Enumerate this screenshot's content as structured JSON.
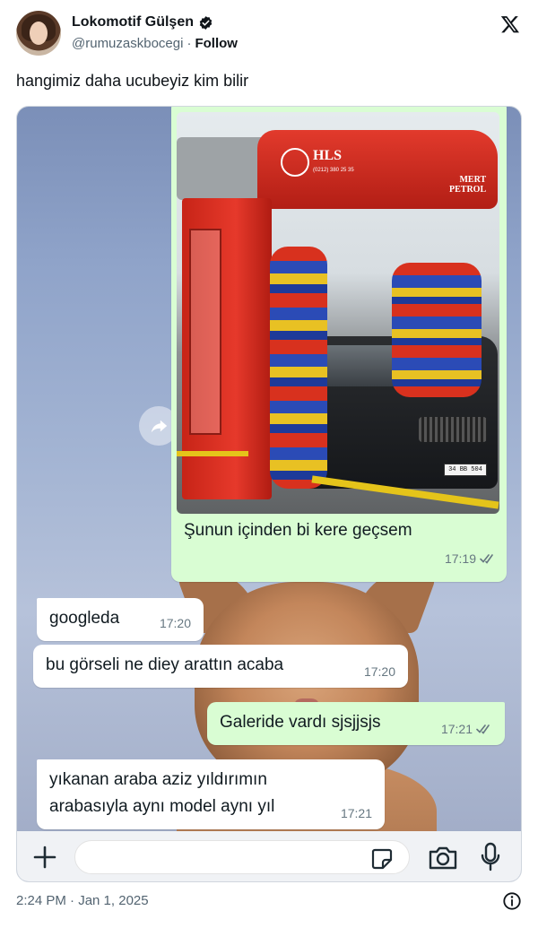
{
  "tweet": {
    "display_name": "Lokomotif Gülşen",
    "handle": "@rumuzaskbocegi",
    "separator": "·",
    "follow_label": "Follow",
    "text": "hangimiz daha ucubeyiz kim bilir",
    "timestamp": "2:24 PM · Jan 1, 2025"
  },
  "photo": {
    "brand": "HLS",
    "phone": "(0212) 380 25 35",
    "sign_line1": "MERT",
    "sign_line2": "PETROL",
    "plate": "34 BB 504"
  },
  "chat": {
    "image_caption": "Şunun içinden bi kere geçsem",
    "image_time": "17:19",
    "messages": [
      {
        "direction": "in",
        "text": "googleda",
        "time": "17:20"
      },
      {
        "direction": "in",
        "text": "bu görseli ne diey arattın acaba",
        "time": "17:20"
      },
      {
        "direction": "out",
        "text": "Galeride vardı sjsjjsjs",
        "time": "17:21"
      },
      {
        "direction": "in",
        "text_line1": "yıkanan araba aziz yıldırımın",
        "text_line2": "arabasıyla aynı model aynı yıl",
        "time": "17:21"
      }
    ]
  },
  "colors": {
    "outgoing_bubble": "#d9fdd3",
    "incoming_bubble": "#ffffff",
    "read_ticks": "#667781",
    "verified": "#1d9bf0"
  },
  "icons": [
    "verified-icon",
    "x-logo-icon",
    "forward-icon",
    "double-check-icon",
    "plus-icon",
    "sticker-icon",
    "camera-icon",
    "mic-icon",
    "info-icon"
  ]
}
